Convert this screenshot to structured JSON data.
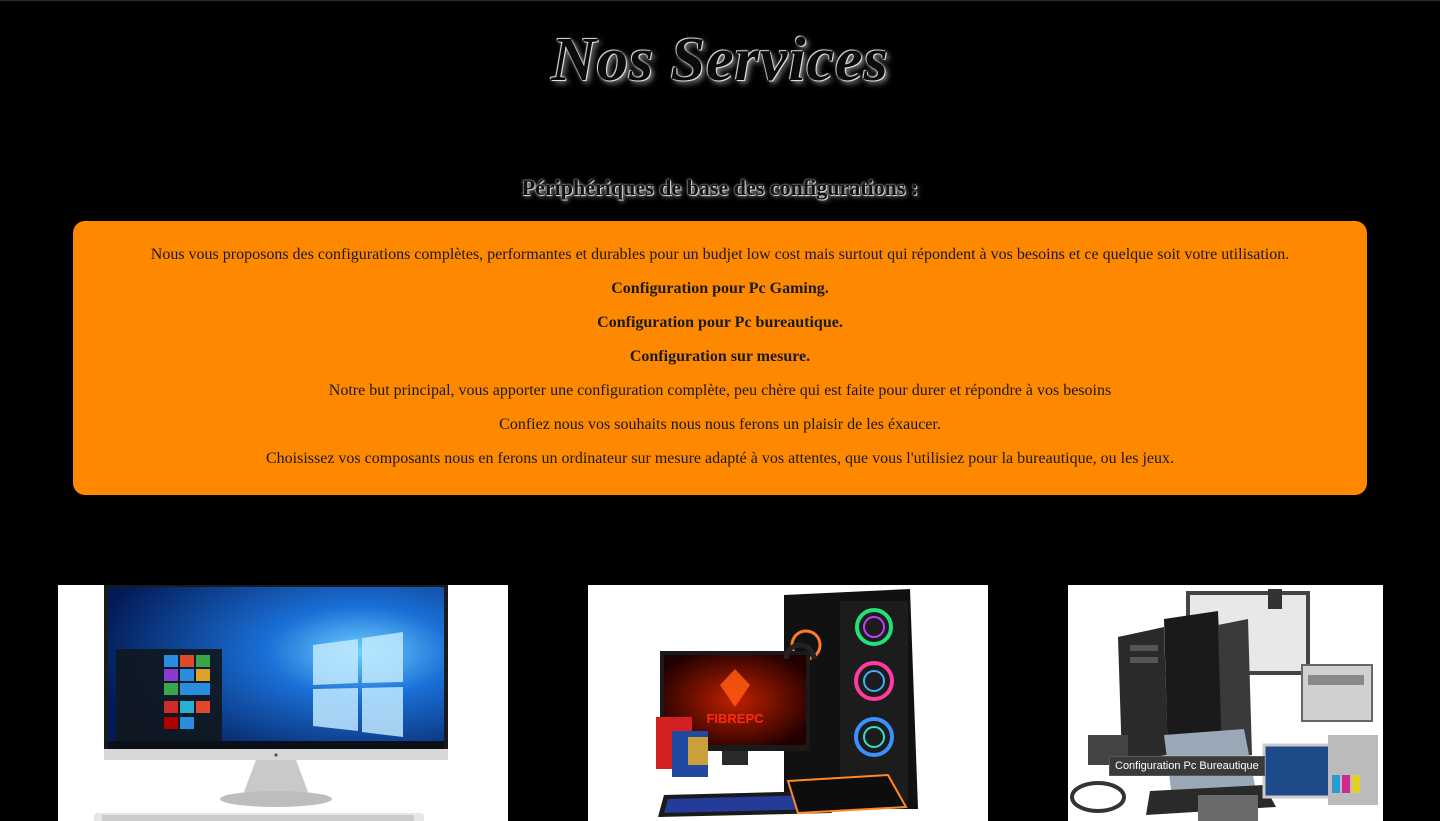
{
  "header": {
    "title": "Nos Services",
    "subtitle": "Périphériques de base des configurations :"
  },
  "info": {
    "intro": "Nous vous proposons des configurations complètes, performantes et durables pour un budjet low cost mais surtout qui répondent à vos besoins et ce quelque soit votre utilisation.",
    "items": [
      "Configuration pour Pc Gaming.",
      "Configuration pour Pc bureautique.",
      "Configuration sur mesure."
    ],
    "goal": "Notre but principal, vous apporter une configuration complète, peu chère qui est faite pour durer et répondre à vos besoins",
    "trust": "Confiez nous vos souhaits nous nous ferons un plaisir de les éxaucer.",
    "choose": "Choisissez vos composants nous en ferons un ordinateur sur mesure adapté à vos attentes, que vous l'utilisiez pour la bureautique, ou les jeux."
  },
  "gallery": {
    "tooltip": "Configuration Pc Bureautique",
    "gaming_screen_text": "FIBREPC"
  },
  "colors": {
    "background": "#000000",
    "accent": "#fe8800"
  }
}
